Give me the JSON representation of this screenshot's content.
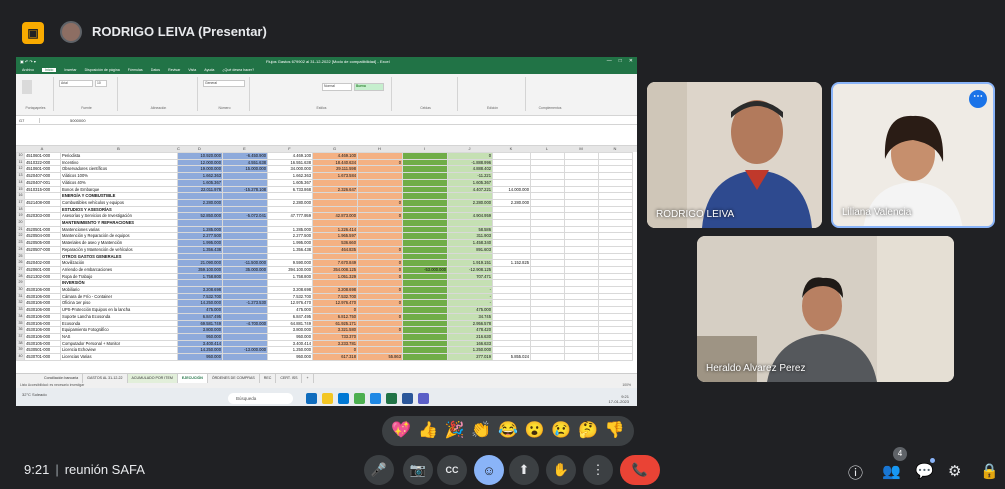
{
  "meeting": {
    "presenter_title": "RODRIGO LEIVA (Presentar)",
    "time": "9:21",
    "name": "reunión SAFA"
  },
  "excel": {
    "window_title": "Flujos Gastos 679902 al 31-12-2022 [Modo de compatibilidad] - Excel",
    "menu": [
      "Archivo",
      "Inicio",
      "Insertar",
      "Disposición de página",
      "Fórmulas",
      "Datos",
      "Revisar",
      "Vista",
      "Ayuda",
      "¿Qué desea hacer?"
    ],
    "ribbon_groups": [
      "Portapapeles",
      "Fuente",
      "Alineación",
      "Número",
      "Estilos",
      "Celdas",
      "Edición",
      "Complementos"
    ],
    "font_name": "Arial",
    "font_size": "10",
    "number_format": "General",
    "style_normal": "Normal",
    "style_buena": "Buena",
    "cell_ref": "G7",
    "formula_value": "5000000",
    "columns": [
      "A",
      "B",
      "C",
      "D",
      "E",
      "F",
      "G",
      "H",
      "I",
      "J",
      "K",
      "L",
      "M",
      "N"
    ],
    "rows": [
      {
        "n": "10",
        "a": "4510601-000",
        "b": "Periodista",
        "d": "10.920.000",
        "e": "-6.450.900",
        "f": "4.469.100",
        "g": "4.469.100",
        "h": "",
        "i": "",
        "j": "0",
        "k": ""
      },
      {
        "n": "11",
        "a": "4510322-000",
        "b": "Incentivo",
        "d": "12.000.000",
        "e": "4.551.638",
        "f": "16.551.638",
        "g": "18.440.634",
        "h": "0",
        "i": "",
        "j": "-1.888.996",
        "k": ""
      },
      {
        "n": "12",
        "a": "4510601-000",
        "b": "Observadores científicos",
        "d": "19.000.000",
        "e": "15.000.000",
        "f": "34.000.000",
        "g": "29.111.598",
        "h": "",
        "i": "",
        "j": "4.888.402",
        "k": ""
      },
      {
        "n": "13",
        "a": "4520407-000",
        "b": "Viáticos 100%",
        "d": "1.662.363",
        "e": "",
        "f": "1.662.363",
        "g": "1.673.584",
        "h": "",
        "i": "",
        "j": "-11.221",
        "k": ""
      },
      {
        "n": "14",
        "a": "4520407-001",
        "b": "Viáticos 40%",
        "d": "1.605.367",
        "e": "",
        "f": "1.605.367",
        "g": "",
        "h": "",
        "i": "",
        "j": "1.605.367",
        "k": ""
      },
      {
        "n": "15",
        "a": "4510315-000",
        "b": "Bonos de Embarque",
        "d": "22.011.978",
        "e": "-15.278.108",
        "f": "6.733.868",
        "g": "2.326.647",
        "h": "",
        "i": "",
        "j": "4.407.221",
        "k": "14.000.000"
      },
      {
        "n": "16",
        "a": "",
        "b": "ENERGÍA Y COMBUSTIBLE",
        "d": "",
        "e": "",
        "f": "",
        "g": "",
        "h": "",
        "i": "",
        "j": "",
        "k": "",
        "bold": true
      },
      {
        "n": "17",
        "a": "4521408-000",
        "b": "Combustibles vehículos y equipos",
        "d": "2.280.000",
        "e": "",
        "f": "2.280.000",
        "g": "",
        "h": "0",
        "i": "",
        "j": "2.280.000",
        "k": "2.280.000"
      },
      {
        "n": "18",
        "a": "",
        "b": "ESTUDIOS Y ASESORÍAS",
        "d": "",
        "e": "",
        "f": "",
        "g": "",
        "h": "",
        "i": "",
        "j": "",
        "k": "",
        "bold": true
      },
      {
        "n": "19",
        "a": "4520303-000",
        "b": "Asesorías y Servicios de Investigación",
        "d": "52.850.000",
        "e": "-5.072.041",
        "f": "47.777.959",
        "g": "42.873.000",
        "h": "0",
        "i": "",
        "j": "4.904.959",
        "k": ""
      },
      {
        "n": "20",
        "a": "",
        "b": "MANTENIMIENTO Y REPARACIONES",
        "d": "",
        "e": "",
        "f": "",
        "g": "",
        "h": "",
        "i": "",
        "j": "",
        "k": "",
        "bold": true
      },
      {
        "n": "21",
        "a": "4520501-000",
        "b": "Mantenciones varias",
        "d": "1.285.000",
        "e": "",
        "f": "1.285.000",
        "g": "1.226.414",
        "h": "",
        "i": "",
        "j": "58.586",
        "k": ""
      },
      {
        "n": "22",
        "a": "4520504-000",
        "b": "Mantención y Reparación de equipos",
        "d": "2.277.500",
        "e": "",
        "f": "2.277.500",
        "g": "1.965.597",
        "h": "",
        "i": "",
        "j": "311.903",
        "k": ""
      },
      {
        "n": "23",
        "a": "4520505-000",
        "b": "Materiales de aseo y Mantención",
        "d": "1.995.000",
        "e": "",
        "f": "1.995.000",
        "g": "536.660",
        "h": "",
        "i": "",
        "j": "1.458.340",
        "k": ""
      },
      {
        "n": "24",
        "a": "4520507-000",
        "b": "Reparación y Mantención de vehículos",
        "d": "1.356.438",
        "e": "",
        "f": "1.356.438",
        "g": "464.835",
        "h": "0",
        "i": "",
        "j": "891.603",
        "k": ""
      },
      {
        "n": "25",
        "a": "",
        "b": "OTROS GASTOS GENERALES",
        "d": "",
        "e": "",
        "f": "",
        "g": "",
        "h": "",
        "i": "",
        "j": "",
        "k": "",
        "bold": true
      },
      {
        "n": "26",
        "a": "4520402-000",
        "b": "Movilización",
        "d": "21.090.000",
        "e": "-11.500.000",
        "f": "9.590.000",
        "g": "7.670.849",
        "h": "0",
        "i": "",
        "j": "1.919.151",
        "k": "1.152.825"
      },
      {
        "n": "27",
        "a": "4520601-000",
        "b": "Arriendo de embarcaciones",
        "d": "359.100.000",
        "e": "35.000.000",
        "f": "394.100.000",
        "g": "354.008.125",
        "h": "0",
        "i": "-53.000.000",
        "j": "-12.908.125",
        "k": ""
      },
      {
        "n": "28",
        "a": "4521302-000",
        "b": "Ropa de Trabajo",
        "d": "1.758.800",
        "e": "",
        "f": "1.758.800",
        "g": "1.051.329",
        "h": "0",
        "i": "",
        "j": "707.471",
        "k": ""
      },
      {
        "n": "29",
        "a": "",
        "b": "INVERSIÓN",
        "d": "",
        "e": "",
        "f": "",
        "g": "",
        "h": "",
        "i": "",
        "j": "",
        "k": "",
        "bold": true
      },
      {
        "n": "30",
        "a": "4530106-000",
        "b": "Mobiliario",
        "d": "3.208.698",
        "e": "",
        "f": "3.208.698",
        "g": "3.208.698",
        "h": "0",
        "i": "",
        "j": "-",
        "k": ""
      },
      {
        "n": "31",
        "a": "4530106-000",
        "b": "Cámara de Frío - Container",
        "d": "7.532.700",
        "e": "",
        "f": "7.532.700",
        "g": "7.532.700",
        "h": "",
        "i": "",
        "j": "-",
        "k": ""
      },
      {
        "n": "32",
        "a": "4530106-000",
        "b": "Oficina 1er piso",
        "d": "14.250.000",
        "e": "-1.273.530",
        "f": "12.976.470",
        "g": "12.976.470",
        "h": "0",
        "i": "",
        "j": "-",
        "k": ""
      },
      {
        "n": "33",
        "a": "4530106-000",
        "b": "UPS-Protección Equipos en la lancha",
        "d": "475.000",
        "e": "",
        "f": "475.000",
        "g": "0",
        "h": "",
        "i": "",
        "j": "475.000",
        "k": ""
      },
      {
        "n": "34",
        "a": "4530106-000",
        "b": "Soporte Lancha Ecosonda",
        "d": "6.847.495",
        "e": "",
        "f": "6.847.495",
        "g": "6.812.750",
        "h": "0",
        "i": "",
        "j": "34.745",
        "k": ""
      },
      {
        "n": "35",
        "a": "4530106-000",
        "b": "Ecosonda",
        "d": "69.581.749",
        "e": "-4.700.000",
        "f": "64.881.749",
        "g": "61.925.171",
        "h": "",
        "i": "",
        "j": "2.956.578",
        "k": ""
      },
      {
        "n": "36",
        "a": "4530106-000",
        "b": "Equipamiento Fotográfico",
        "d": "3.800.000",
        "e": "",
        "f": "3.800.000",
        "g": "3.321.580",
        "h": "0",
        "i": "",
        "j": "478.420",
        "k": ""
      },
      {
        "n": "37",
        "a": "4530106-000",
        "b": "NAS",
        "d": "950.000",
        "e": "",
        "f": "950.000",
        "g": "733.370",
        "h": "",
        "i": "",
        "j": "216.630",
        "k": ""
      },
      {
        "n": "38",
        "a": "4530105-000",
        "b": "Computador Personal + Monitor",
        "d": "3.400.414",
        "e": "",
        "f": "3.400.414",
        "g": "3.233.781",
        "h": "",
        "i": "",
        "j": "166.633",
        "k": ""
      },
      {
        "n": "39",
        "a": "4530501-000",
        "b": "Licencia Echoview",
        "d": "14.250.000",
        "e": "-13.000.000",
        "f": "1.250.000",
        "g": "0",
        "h": "",
        "i": "",
        "j": "1.250.000",
        "k": ""
      },
      {
        "n": "40",
        "a": "4530701-000",
        "b": "Licencias Varias",
        "d": "950.000",
        "e": "",
        "f": "950.000",
        "g": "617.318",
        "h": "55.863",
        "i": "",
        "j": "277.019",
        "k": "5.855.024"
      }
    ],
    "sheet_tabs": [
      "Conciliación bancaria",
      "GASTOS AL 31-12-22",
      "ACUMULADO POR ITEM",
      "EJECUCIÓN",
      "ÓRDENES DE COMPRAS",
      "REC",
      "CERT. ISS",
      "+"
    ],
    "status": "Listo   Accesibilidad: es necesario investigar",
    "zoom": "100%"
  },
  "taskbar": {
    "weather": "32°C Soleado",
    "search_placeholder": "Búsqueda",
    "clock_time": "9:21",
    "clock_date": "17-01-2023"
  },
  "participants": [
    {
      "name": "RODRIGO LEIVA"
    },
    {
      "name": "Liliana Valencia"
    },
    {
      "name": "Heraldo Alvarez Perez"
    }
  ],
  "reactions": [
    "💖",
    "👍",
    "🎉",
    "👏",
    "😂",
    "😮",
    "😢",
    "🤔",
    "👎"
  ],
  "controls": {
    "mic": "🎤",
    "camera": "📷",
    "captions": "CC",
    "reaction": "☺",
    "present": "⬆",
    "raise_hand": "✋",
    "more": "⋮",
    "hangup": "📞"
  },
  "right_controls": {
    "info": "ⓘ",
    "people": "👥",
    "people_count": "4",
    "chat": "💬",
    "activities": "⚙",
    "host": "🔒"
  }
}
